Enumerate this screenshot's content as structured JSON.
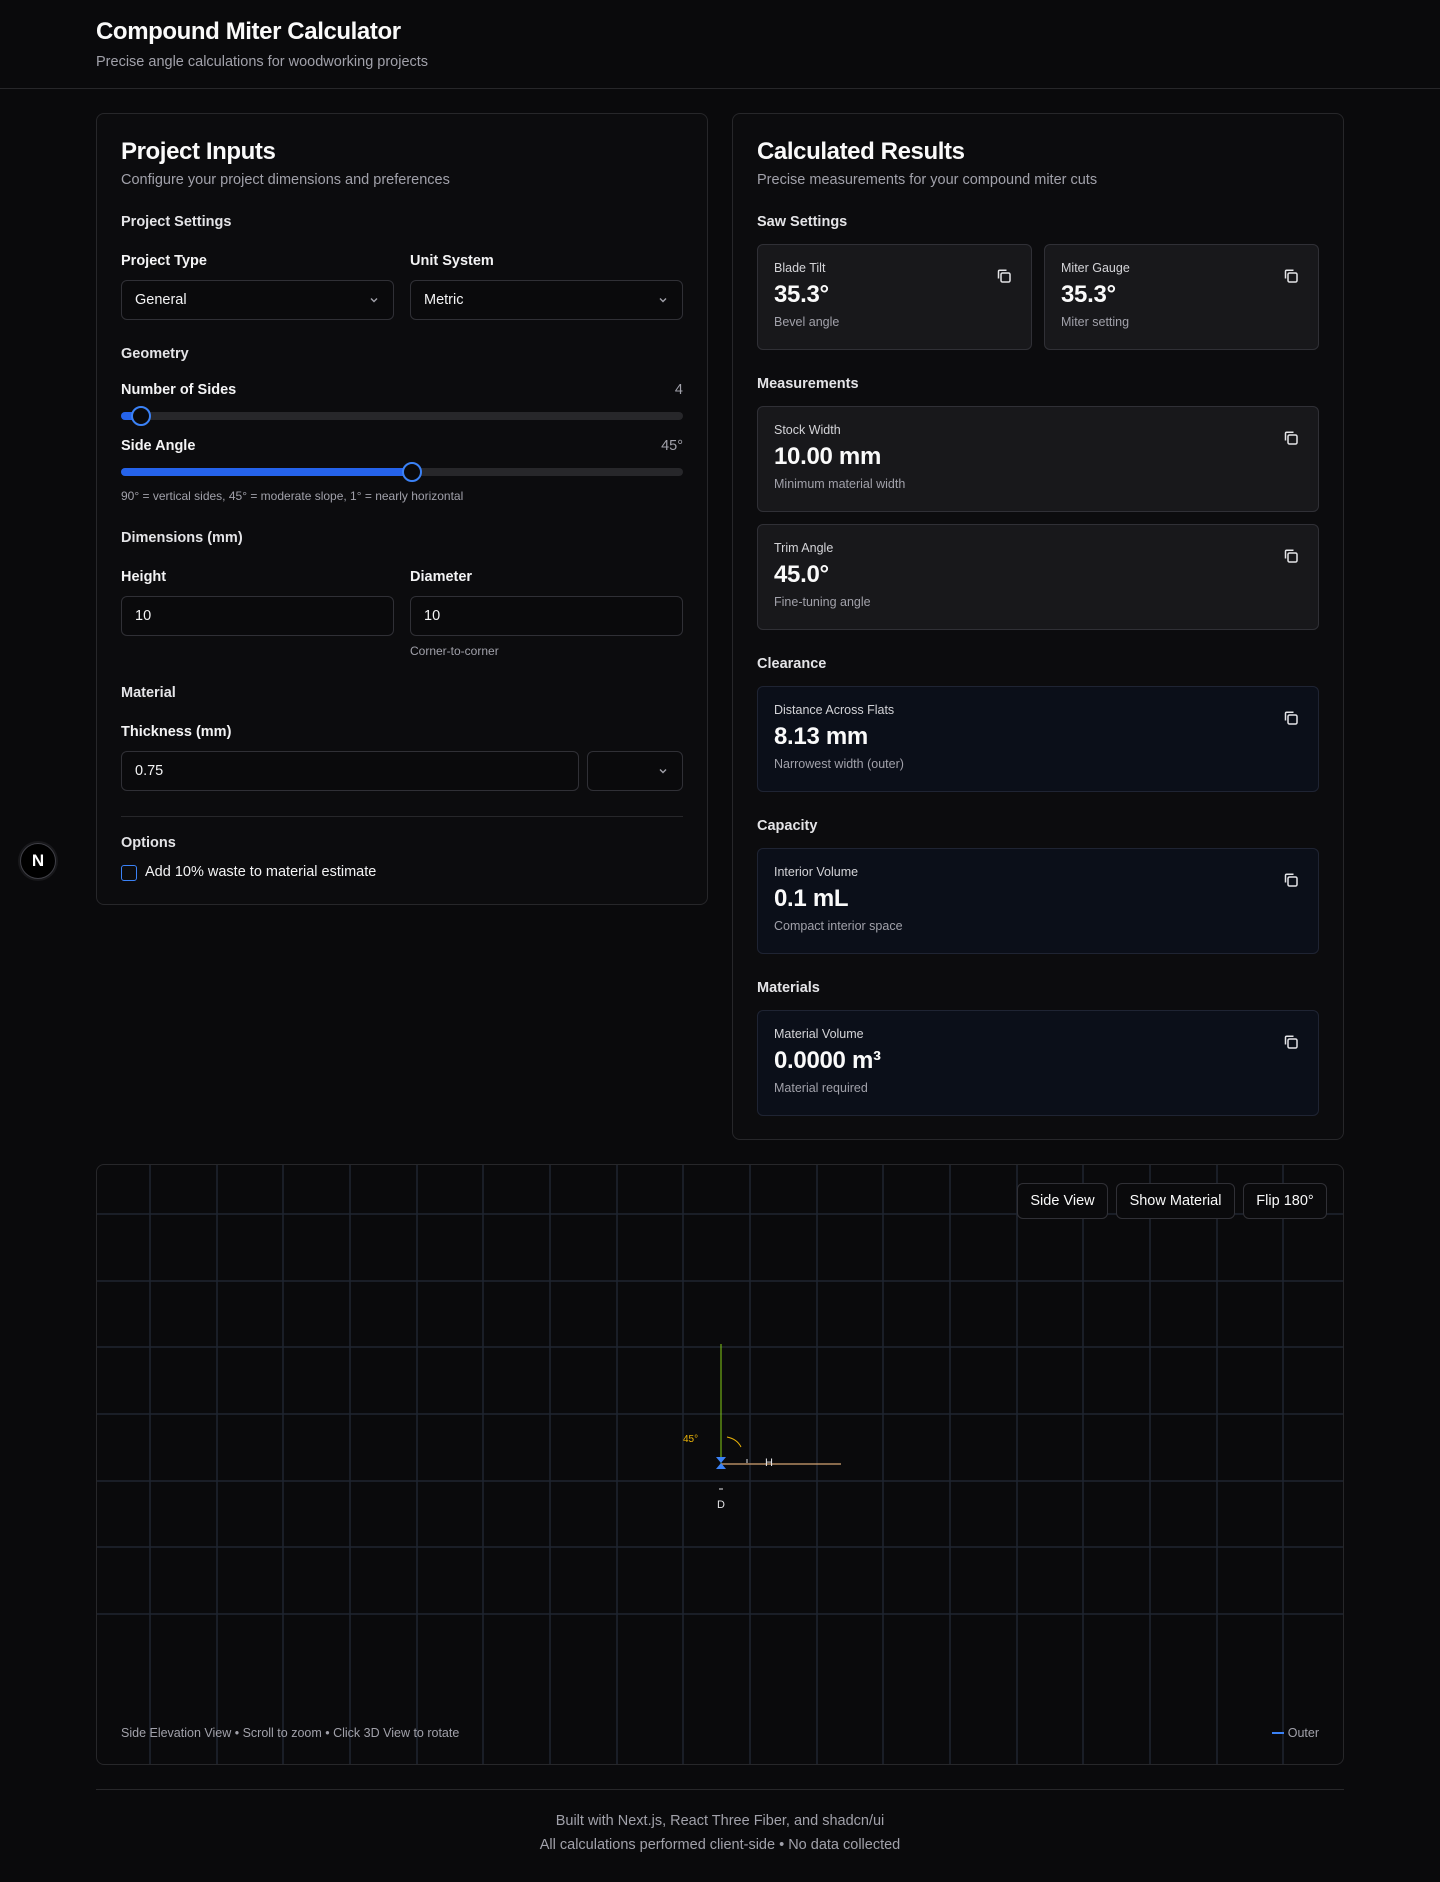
{
  "header": {
    "title": "Compound Miter Calculator",
    "subtitle": "Precise angle calculations for woodworking projects"
  },
  "inputs": {
    "title": "Project Inputs",
    "description": "Configure your project dimensions and preferences",
    "settings_heading": "Project Settings",
    "project_type_label": "Project Type",
    "project_type_value": "General",
    "unit_system_label": "Unit System",
    "unit_system_value": "Metric",
    "geometry_heading": "Geometry",
    "sides_label": "Number of Sides",
    "sides_value": "4",
    "sides_fraction": 0.0,
    "angle_label": "Side Angle",
    "angle_value": "45°",
    "angle_fraction": 0.5,
    "angle_hint": "90° = vertical sides, 45° = moderate slope, 1° = nearly horizontal",
    "dimensions_heading": "Dimensions (mm)",
    "height_label": "Height",
    "height_value": "10",
    "diameter_label": "Diameter",
    "diameter_value": "10",
    "diameter_hint": "Corner-to-corner",
    "material_heading": "Material",
    "thickness_label": "Thickness (mm)",
    "thickness_value": "0.75",
    "thickness_unit_value": "",
    "options_heading": "Options",
    "waste_label": "Add 10% waste to material estimate",
    "waste_checked": false
  },
  "results": {
    "title": "Calculated Results",
    "description": "Precise measurements for your compound miter cuts",
    "saw_heading": "Saw Settings",
    "blade_tilt": {
      "label": "Blade Tilt",
      "value": "35.3°",
      "sub": "Bevel angle"
    },
    "miter_gauge": {
      "label": "Miter Gauge",
      "value": "35.3°",
      "sub": "Miter setting"
    },
    "measurements_heading": "Measurements",
    "stock_width": {
      "label": "Stock Width",
      "value": "10.00 mm",
      "sub": "Minimum material width"
    },
    "trim_angle": {
      "label": "Trim Angle",
      "value": "45.0°",
      "sub": "Fine-tuning angle"
    },
    "clearance_heading": "Clearance",
    "flats": {
      "label": "Distance Across Flats",
      "value": "8.13 mm",
      "sub": "Narrowest width (outer)"
    },
    "capacity_heading": "Capacity",
    "interior_volume": {
      "label": "Interior Volume",
      "value": "0.1 mL",
      "sub": "Compact interior space"
    },
    "materials_heading": "Materials",
    "material_volume": {
      "label": "Material Volume",
      "value": "0.0000 m³",
      "sub": "Material required"
    }
  },
  "viewer": {
    "side_view_label": "Side View",
    "show_material_label": "Show Material",
    "flip_label": "Flip 180°",
    "angle_annotation": "45°",
    "h_label": "H",
    "d_label": "D",
    "caption": "Side Elevation View • Scroll to zoom • Click 3D View to rotate",
    "legend_label": "Outer",
    "colors": {
      "grid": "#1f2530",
      "outer": "#3b82f6",
      "height_axis": "#84cc16",
      "base": "#d4a373",
      "angle": "#eab308"
    }
  },
  "footer": {
    "line1": "Built with Next.js, React Three Fiber, and shadcn/ui",
    "line2": "All calculations performed client-side • No data collected"
  },
  "badge": {
    "letter": "N"
  }
}
